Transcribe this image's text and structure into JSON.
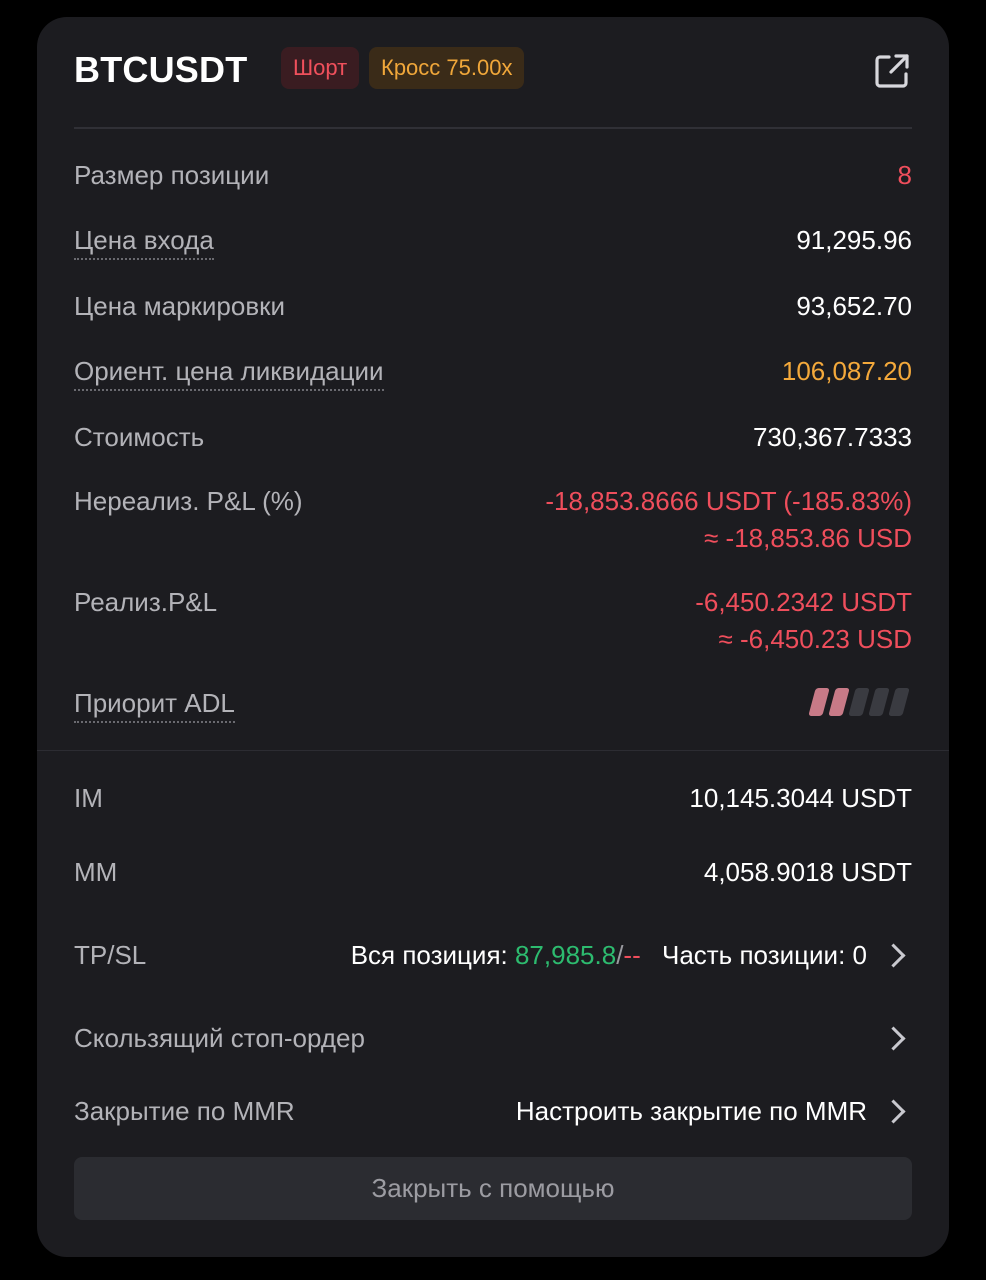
{
  "header": {
    "symbol": "BTCUSDT",
    "side_badge": "Шорт",
    "margin_badge": "Кросс 75.00x",
    "external_icon": "external-link-icon"
  },
  "rows": {
    "position_size": {
      "label": "Размер позиции",
      "value": "8"
    },
    "entry_price": {
      "label": "Цена входа",
      "value": "91,295.96"
    },
    "mark_price": {
      "label": "Цена маркировки",
      "value": "93,652.70"
    },
    "liq_price": {
      "label": "Ориент. цена ликвидации",
      "value": "106,087.20"
    },
    "value": {
      "label": "Стоимость",
      "value": "730,367.7333"
    },
    "unrealized_pnl": {
      "label": "Нереализ. P&L (%)",
      "value_line1": "-18,853.8666 USDT (-185.83%)",
      "value_line2": "≈ -18,853.86 USD"
    },
    "realized_pnl": {
      "label": "Реализ.P&L",
      "value_line1": "-6,450.2342 USDT",
      "value_line2": "≈ -6,450.23 USD"
    },
    "adl": {
      "label": "Приорит ADL",
      "level": 2,
      "levels_total": 5
    },
    "im": {
      "label": "IM",
      "value": "10,145.3044 USDT"
    },
    "mm": {
      "label": "MM",
      "value": "4,058.9018 USDT"
    },
    "tpsl": {
      "label": "TP/SL",
      "full_label": "Вся позиция: ",
      "tp_value": "87,985.8",
      "slash": "/",
      "sl_value": "--",
      "partial_label": "Часть позиции: 0"
    },
    "trailing_stop": {
      "label": "Скользящий стоп-ордер"
    },
    "mmr_close": {
      "label": "Закрытие по MMR",
      "action": "Настроить закрытие по MMR"
    }
  },
  "close_button": {
    "label": "Закрыть с помощью"
  },
  "colors": {
    "card": "#1c1c20",
    "red": "#ef4e5c",
    "orange": "#f4a93b",
    "green": "#2dbb6f",
    "adl_active": "#c77a87",
    "adl_inactive": "#3a3b41"
  }
}
